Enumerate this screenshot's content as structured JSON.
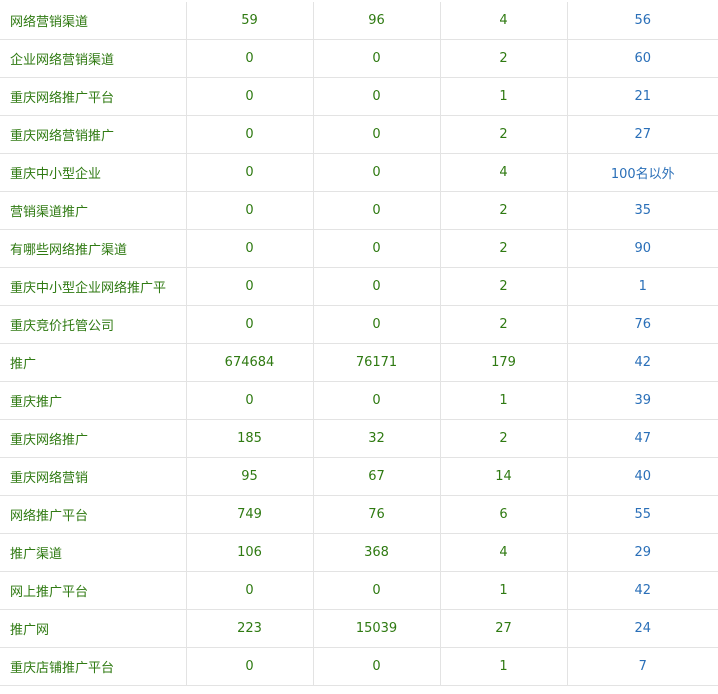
{
  "rows": [
    {
      "keyword": "网络营销渠道",
      "col2": "59",
      "col3": "96",
      "col4": "4",
      "rank": "56"
    },
    {
      "keyword": "企业网络营销渠道",
      "col2": "0",
      "col3": "0",
      "col4": "2",
      "rank": "60"
    },
    {
      "keyword": "重庆网络推广平台",
      "col2": "0",
      "col3": "0",
      "col4": "1",
      "rank": "21"
    },
    {
      "keyword": "重庆网络营销推广",
      "col2": "0",
      "col3": "0",
      "col4": "2",
      "rank": "27"
    },
    {
      "keyword": "重庆中小型企业",
      "col2": "0",
      "col3": "0",
      "col4": "4",
      "rank": "100名以外"
    },
    {
      "keyword": "营销渠道推广",
      "col2": "0",
      "col3": "0",
      "col4": "2",
      "rank": "35"
    },
    {
      "keyword": "有哪些网络推广渠道",
      "col2": "0",
      "col3": "0",
      "col4": "2",
      "rank": "90"
    },
    {
      "keyword": "重庆中小型企业网络推广平",
      "col2": "0",
      "col3": "0",
      "col4": "2",
      "rank": "1"
    },
    {
      "keyword": "重庆竞价托管公司",
      "col2": "0",
      "col3": "0",
      "col4": "2",
      "rank": "76"
    },
    {
      "keyword": "推广",
      "col2": "674684",
      "col3": "76171",
      "col4": "179",
      "rank": "42"
    },
    {
      "keyword": "重庆推广",
      "col2": "0",
      "col3": "0",
      "col4": "1",
      "rank": "39"
    },
    {
      "keyword": "重庆网络推广",
      "col2": "185",
      "col3": "32",
      "col4": "2",
      "rank": "47"
    },
    {
      "keyword": "重庆网络营销",
      "col2": "95",
      "col3": "67",
      "col4": "14",
      "rank": "40"
    },
    {
      "keyword": "网络推广平台",
      "col2": "749",
      "col3": "76",
      "col4": "6",
      "rank": "55"
    },
    {
      "keyword": "推广渠道",
      "col2": "106",
      "col3": "368",
      "col4": "4",
      "rank": "29"
    },
    {
      "keyword": "网上推广平台",
      "col2": "0",
      "col3": "0",
      "col4": "1",
      "rank": "42"
    },
    {
      "keyword": "推广网",
      "col2": "223",
      "col3": "15039",
      "col4": "27",
      "rank": "24"
    },
    {
      "keyword": "重庆店铺推广平台",
      "col2": "0",
      "col3": "0",
      "col4": "1",
      "rank": "7"
    }
  ],
  "colors": {
    "text_green": "#2f7a12",
    "rank_blue": "#2a6fb8",
    "border": "#e3e3e3"
  }
}
